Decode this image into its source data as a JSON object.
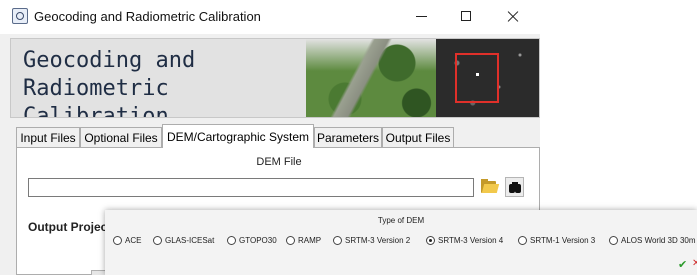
{
  "window": {
    "title": "Geocoding and Radiometric Calibration"
  },
  "banner": {
    "title": "Geocoding and Radiometric Calibration"
  },
  "tabs": [
    {
      "label": "Input Files"
    },
    {
      "label": "Optional Files"
    },
    {
      "label": "DEM/Cartographic System",
      "active": true
    },
    {
      "label": "Parameters"
    },
    {
      "label": "Output Files"
    }
  ],
  "dem": {
    "label": "DEM File",
    "value": ""
  },
  "output_projection": {
    "label": "Output Projec"
  },
  "dem_type": {
    "label": "Type of DEM",
    "selected": "SRTM-3 Version 4",
    "options": [
      "ACE",
      "GLAS-ICESat",
      "GTOPO30",
      "RAMP",
      "SRTM-3 Version 2",
      "SRTM-3 Version 4",
      "SRTM-1 Version 3",
      "ALOS World 3D 30m"
    ]
  },
  "actions": {
    "ok_glyph": "✔",
    "cancel_glyph": "✕"
  },
  "colors": {
    "accent_red": "#e0302a",
    "ok_green": "#2a9a2a",
    "cancel_red": "#d02a2a"
  }
}
